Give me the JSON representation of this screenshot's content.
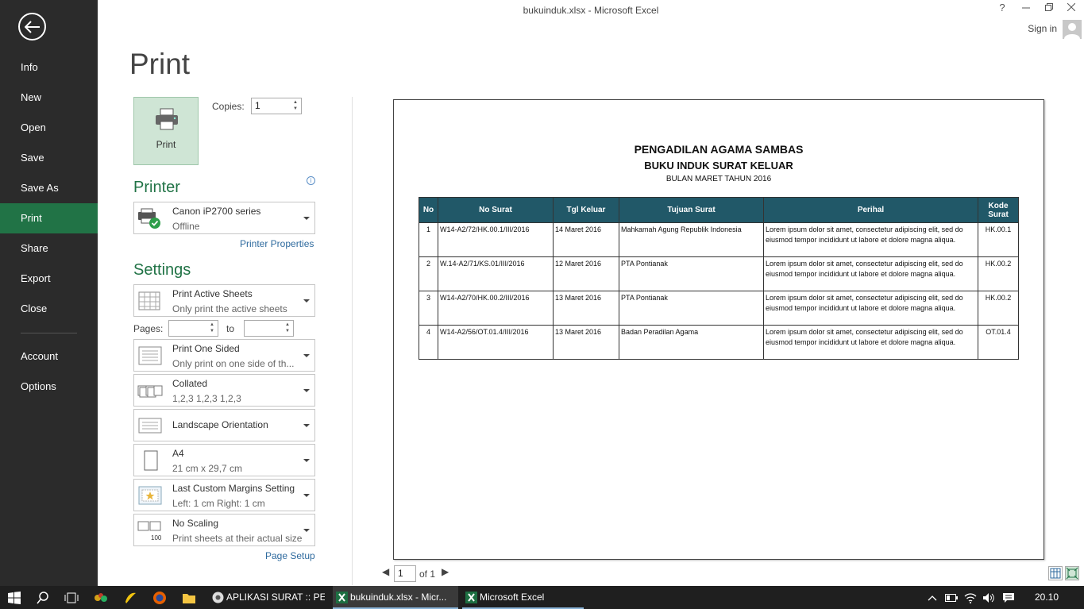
{
  "window": {
    "title": "bukuinduk.xlsx - Microsoft Excel",
    "help": "?",
    "signin": "Sign in"
  },
  "sidebar": {
    "items": [
      {
        "label": "Info"
      },
      {
        "label": "New"
      },
      {
        "label": "Open"
      },
      {
        "label": "Save"
      },
      {
        "label": "Save As"
      },
      {
        "label": "Print"
      },
      {
        "label": "Share"
      },
      {
        "label": "Export"
      },
      {
        "label": "Close"
      },
      {
        "label": "Account"
      },
      {
        "label": "Options"
      }
    ],
    "active": "Print"
  },
  "page_title": "Print",
  "print": {
    "button_label": "Print",
    "copies_label": "Copies:",
    "copies_value": "1"
  },
  "printer": {
    "heading": "Printer",
    "name": "Canon iP2700 series",
    "status": "Offline",
    "properties_link": "Printer Properties"
  },
  "settings": {
    "heading": "Settings",
    "what": {
      "title": "Print Active Sheets",
      "sub": "Only print the active sheets"
    },
    "pages_label": "Pages:",
    "pages_to": "to",
    "sides": {
      "title": "Print One Sided",
      "sub": "Only print on one side of th..."
    },
    "collate": {
      "title": "Collated",
      "sub": "1,2,3    1,2,3    1,2,3"
    },
    "orientation": {
      "title": "Landscape Orientation"
    },
    "paper": {
      "title": "A4",
      "sub": "21 cm x 29,7 cm"
    },
    "margins": {
      "title": "Last Custom Margins Setting",
      "sub": "Left:  1 cm    Right:  1 cm"
    },
    "scaling": {
      "title": "No Scaling",
      "sub": "Print sheets at their actual size"
    },
    "page_setup_link": "Page Setup"
  },
  "preview": {
    "title1": "PENGADILAN AGAMA SAMBAS",
    "title2": "BUKU INDUK SURAT KELUAR",
    "title3": "BULAN MARET TAHUN 2016",
    "headers": [
      "No",
      "No Surat",
      "Tgl Keluar",
      "Tujuan Surat",
      "Perihal",
      "Kode Surat"
    ],
    "rows": [
      [
        "1",
        "W14-A2/72/HK.00.1/III/2016",
        "14 Maret 2016",
        "Mahkamah Agung Republik Indonesia",
        "Lorem ipsum dolor sit amet, consectetur adipiscing elit, sed do eiusmod tempor incididunt ut labore et dolore magna aliqua.",
        "HK.00.1"
      ],
      [
        "2",
        "W.14-A2/71/KS.01/III/2016",
        "12 Maret 2016",
        "PTA Pontianak",
        "Lorem ipsum dolor sit amet, consectetur adipiscing elit, sed do eiusmod tempor incididunt ut labore et dolore magna aliqua.",
        "HK.00.2"
      ],
      [
        "3",
        "W14-A2/70/HK.00.2/III/2016",
        "13 Maret 2016",
        "PTA Pontianak",
        "Lorem ipsum dolor sit amet, consectetur adipiscing elit, sed do eiusmod tempor incididunt ut labore et dolore magna aliqua.",
        "HK.00.2"
      ],
      [
        "4",
        "W14-A2/56/OT.01.4/III/2016",
        "13 Maret 2016",
        "Badan Peradilan Agama",
        "Lorem ipsum dolor sit amet, consectetur adipiscing elit, sed do eiusmod tempor incididunt ut labore et dolore magna aliqua.",
        "OT.01.4"
      ]
    ],
    "page_current": "1",
    "page_of": "of 1"
  },
  "taskbar": {
    "apps": [
      {
        "label": "APLIKASI SURAT :: PE..."
      },
      {
        "label": "bukuinduk.xlsx - Micr..."
      },
      {
        "label": "Microsoft Excel"
      }
    ],
    "clock": "20.10"
  },
  "colors": {
    "accent": "#217346",
    "table_header": "#215868",
    "sidebar": "#2b2b2b"
  }
}
